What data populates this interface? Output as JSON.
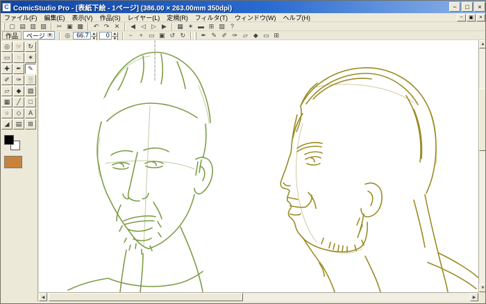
{
  "window": {
    "title": "ComicStudio Pro - [表紙下絵 - 1ページ] (386.00 × 263.00mm 350dpi)",
    "app_initial": "C",
    "controls": {
      "minimize": "−",
      "maximize": "□",
      "close": "×"
    },
    "mdi_controls": {
      "minimize": "−",
      "restore": "▣",
      "close": "×"
    }
  },
  "menubar": {
    "items": [
      {
        "label": "ファイル(F)"
      },
      {
        "label": "編集(E)"
      },
      {
        "label": "表示(V)"
      },
      {
        "label": "作品(S)"
      },
      {
        "label": "レイヤー(L)"
      },
      {
        "label": "定規(R)"
      },
      {
        "label": "フィルタ(T)"
      },
      {
        "label": "ウィンドウ(W)"
      },
      {
        "label": "ヘルプ(H)"
      }
    ]
  },
  "toolbar_main": {
    "icons": [
      {
        "name": "new-document",
        "glyph": "▢"
      },
      {
        "name": "open",
        "glyph": "▤"
      },
      {
        "name": "save",
        "glyph": "▥"
      },
      {
        "name": "print",
        "glyph": "▧"
      },
      {
        "name": "cut",
        "glyph": "✂"
      },
      {
        "name": "copy",
        "glyph": "▣"
      },
      {
        "name": "paste",
        "glyph": "▩"
      },
      {
        "name": "undo",
        "glyph": "↶"
      },
      {
        "name": "redo",
        "glyph": "↷"
      },
      {
        "name": "delete",
        "glyph": "✕"
      },
      {
        "name": "first-page",
        "glyph": "◀"
      },
      {
        "name": "prev-page",
        "glyph": "◁"
      },
      {
        "name": "next-page",
        "glyph": "▷"
      },
      {
        "name": "last-page",
        "glyph": "▶"
      },
      {
        "name": "layers-palette",
        "glyph": "▦"
      },
      {
        "name": "tools-palette",
        "glyph": "✶"
      },
      {
        "name": "story-editor",
        "glyph": "▬"
      },
      {
        "name": "grid-toggle",
        "glyph": "⊞"
      },
      {
        "name": "materials-palette",
        "glyph": "▨"
      },
      {
        "name": "help",
        "glyph": "?"
      }
    ]
  },
  "toolbar_view": {
    "tab_works": "作品",
    "tab_page": "ページ",
    "page_dropdown_arrow": "▼",
    "zoom_icon": "◎",
    "zoom_value": "66.7",
    "rotation_value": "0",
    "view_icons": [
      {
        "name": "zoom-out",
        "glyph": "−"
      },
      {
        "name": "zoom-in",
        "glyph": "+"
      },
      {
        "name": "fit-to-window",
        "glyph": "▭"
      },
      {
        "name": "actual-size",
        "glyph": "▣"
      },
      {
        "name": "rotate-ccw",
        "glyph": "↺"
      },
      {
        "name": "rotate-cw",
        "glyph": "↻"
      }
    ],
    "draw_icons": [
      {
        "name": "pen-tool",
        "glyph": "✒"
      },
      {
        "name": "pencil-tool",
        "glyph": "✎"
      },
      {
        "name": "marker-tool",
        "glyph": "✐"
      },
      {
        "name": "brush-tool",
        "glyph": "✑"
      },
      {
        "name": "eraser-tool",
        "glyph": "▱"
      },
      {
        "name": "fill-tool",
        "glyph": "◆"
      },
      {
        "name": "selection-tool",
        "glyph": "▭"
      },
      {
        "name": "snap-toggle",
        "glyph": "⊞"
      }
    ]
  },
  "toolbox": {
    "tools": [
      {
        "name": "zoom",
        "glyph": "◎"
      },
      {
        "name": "hand",
        "glyph": "☞"
      },
      {
        "name": "rotate-canvas",
        "glyph": "↻"
      },
      {
        "name": "rect-select",
        "glyph": "▭"
      },
      {
        "name": "lasso",
        "glyph": "◌"
      },
      {
        "name": "magic-wand",
        "glyph": "✶"
      },
      {
        "name": "move",
        "glyph": "✚"
      },
      {
        "name": "pen",
        "glyph": "✒"
      },
      {
        "name": "pencil",
        "glyph": "✎"
      },
      {
        "name": "marker",
        "glyph": "✐"
      },
      {
        "name": "brush",
        "glyph": "✑"
      },
      {
        "name": "airbrush",
        "glyph": "░"
      },
      {
        "name": "eraser",
        "glyph": "▱"
      },
      {
        "name": "fill",
        "glyph": "◆"
      },
      {
        "name": "gradient",
        "glyph": "▨"
      },
      {
        "name": "tone",
        "glyph": "▦"
      },
      {
        "name": "line",
        "glyph": "╱"
      },
      {
        "name": "rectangle",
        "glyph": "□"
      },
      {
        "name": "ellipse",
        "glyph": "○"
      },
      {
        "name": "polygon",
        "glyph": "◇"
      },
      {
        "name": "text",
        "glyph": "A"
      },
      {
        "name": "eyedropper",
        "glyph": "◢"
      },
      {
        "name": "ruler",
        "glyph": "▤"
      },
      {
        "name": "panel-cutter",
        "glyph": "⊞"
      }
    ],
    "swatches": {
      "foreground": "#000000",
      "background": "#ffffff",
      "tone_preview": "#c8823c"
    }
  },
  "canvas": {
    "page_color": "#ffffff",
    "sketch_green": "#7d9c46",
    "sketch_olive": "#9a8b22",
    "guide_color": "#9a9a9a"
  },
  "scrollbars": {
    "up": "▲",
    "down": "▼",
    "left": "◀",
    "right": "▶"
  }
}
